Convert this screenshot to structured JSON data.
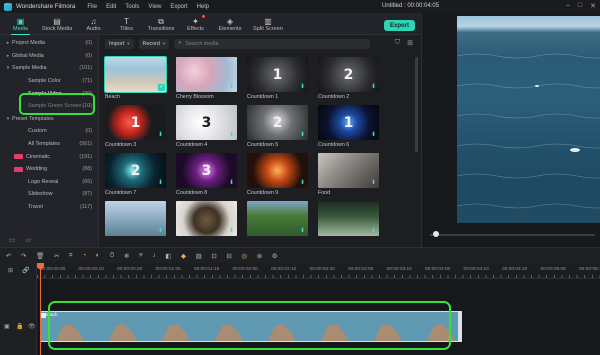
{
  "titlebar": {
    "app_name": "Wondershare Filmora",
    "menu": [
      "File",
      "Edit",
      "Tools",
      "View",
      "Export",
      "Help"
    ],
    "doc_title": "Untitled : 00:00:04:05"
  },
  "toolbar": {
    "tabs": [
      {
        "label": "Media",
        "icon": "folder-icon",
        "active": true
      },
      {
        "label": "Stock Media",
        "icon": "stock-icon"
      },
      {
        "label": "Audio",
        "icon": "music-note-icon"
      },
      {
        "label": "Titles",
        "icon": "text-T-icon"
      },
      {
        "label": "Transitions",
        "icon": "transition-icon"
      },
      {
        "label": "Effects",
        "icon": "effects-icon",
        "badge": true
      },
      {
        "label": "Elements",
        "icon": "elements-icon"
      },
      {
        "label": "Split Screen",
        "icon": "split-screen-icon"
      }
    ],
    "export_label": "Export",
    "accent_color": "#2fd3b5"
  },
  "folders": [
    {
      "label": "Project Media",
      "count": "(0)",
      "arrow": "▸",
      "indent": 0
    },
    {
      "label": "Global Media",
      "count": "(0)",
      "arrow": "▸",
      "indent": 0
    },
    {
      "label": "Sample Media",
      "count": "(101)",
      "arrow": "▾",
      "indent": 0
    },
    {
      "label": "Sample Color",
      "count": "(71)",
      "indent": 1
    },
    {
      "label": "Sample Video",
      "count": "(20)",
      "indent": 1,
      "selected": true
    },
    {
      "label": "Sample Green Screen",
      "count": "(10)",
      "indent": 1
    },
    {
      "label": "Preset Templates",
      "count": "",
      "arrow": "▾",
      "indent": 0
    },
    {
      "label": "Custom",
      "count": "(0)",
      "indent": 1
    },
    {
      "label": "All Templates",
      "count": "(561)",
      "indent": 1
    },
    {
      "label": "Cinematic",
      "count": "(191)",
      "indent": 1,
      "tag": true
    },
    {
      "label": "Wedding",
      "count": "(88)",
      "indent": 1,
      "tag": true
    },
    {
      "label": "Logo Reveal",
      "count": "(66)",
      "indent": 1
    },
    {
      "label": "Slideshow",
      "count": "(87)",
      "indent": 1
    },
    {
      "label": "Travel",
      "count": "(117)",
      "indent": 1
    }
  ],
  "media_bar": {
    "import_label": "Import",
    "record_label": "Record",
    "search_placeholder": "Search media"
  },
  "media_items": [
    {
      "label": "Beach",
      "style": "beach",
      "selected": true
    },
    {
      "label": "Cherry Blossom",
      "style": "cherry"
    },
    {
      "label": "Countdown 1",
      "style": "cd-dark",
      "digit": "1"
    },
    {
      "label": "Countdown 2",
      "style": "cd-dark",
      "digit": "2"
    },
    {
      "label": "Countdown 3",
      "style": "cd-red",
      "digit": "1"
    },
    {
      "label": "Countdown 4",
      "style": "cd-white",
      "digit": "3"
    },
    {
      "label": "Countdown 5",
      "style": "cd-gray",
      "digit": "2"
    },
    {
      "label": "Countdown 6",
      "style": "cd-blue",
      "digit": "1"
    },
    {
      "label": "Countdown 7",
      "style": "cd-teal",
      "digit": "2"
    },
    {
      "label": "Countdown 8",
      "style": "cd-purple",
      "digit": "3"
    },
    {
      "label": "Countdown 9",
      "style": "cd-orange",
      "digit": ""
    },
    {
      "label": "Food",
      "style": "food"
    },
    {
      "label": "",
      "style": "lake"
    },
    {
      "label": "",
      "style": "bowl"
    },
    {
      "label": "",
      "style": "bike"
    },
    {
      "label": "",
      "style": "tree"
    }
  ],
  "timeline": {
    "ruler_ticks": [
      "00:00:00:00",
      "00:00:00:10",
      "00:00:00:20",
      "00:00:01:05",
      "00:00:01:15",
      "00:00:02:00",
      "00:00:02:10",
      "00:00:02:20",
      "00:00:03:05",
      "00:00:03:15",
      "00:00:04:00",
      "00:00:04:10",
      "00:00:04:20",
      "00:00:05:05",
      "00:00:05:15"
    ],
    "clip_label": "Beach"
  }
}
